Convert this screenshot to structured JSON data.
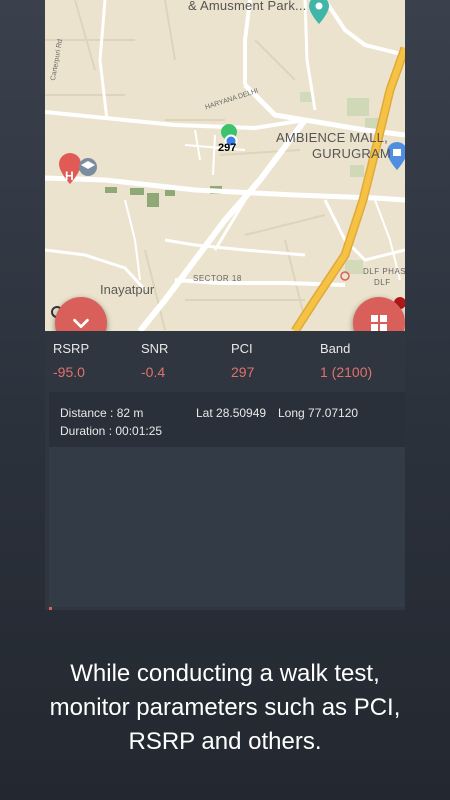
{
  "map": {
    "labels": {
      "amusement_park": "& Amusment Park...",
      "carterpuri_rd": "Carterpuri Rd",
      "haryana_delhi": "HARYANA DELHI",
      "ambience_mall_line1": "AMBIENCE MALL,",
      "ambience_mall_line2": "GURUGRAM",
      "inayatpur": "Inayatpur",
      "sector_18": "SECTOR 18",
      "dlf_phase_line1": "DLF PHASE",
      "dlf_phase_line2": "DLF",
      "map_marker_h": "H"
    },
    "pci_marker": "297",
    "colors": {
      "land": "#ebe3cd",
      "road": "#ffffff",
      "highway": "#f6c244",
      "park": "#8fa876",
      "marker_green": "#3cc36b",
      "marker_blue": "#3d7fe8"
    }
  },
  "buttons": {
    "collapse_icon": "chevron-down",
    "layout_icon": "grid"
  },
  "stats": {
    "rsrp": {
      "label": "RSRP",
      "value": "-95.0"
    },
    "snr": {
      "label": "SNR",
      "value": "-0.4"
    },
    "pci": {
      "label": "PCI",
      "value": "297"
    },
    "band": {
      "label": "Band",
      "value": "1 (2100)"
    }
  },
  "details": {
    "distance": "Distance : 82 m",
    "duration": "Duration : 00:01:25",
    "lat": "Lat 28.50949",
    "long": "Long 77.07120"
  },
  "caption": {
    "line1": "While conducting a walk test,",
    "line2": "monitor parameters such as PCI,",
    "line3": "RSRP and others."
  },
  "accent": "#d9605a",
  "value_color": "#e3716b"
}
